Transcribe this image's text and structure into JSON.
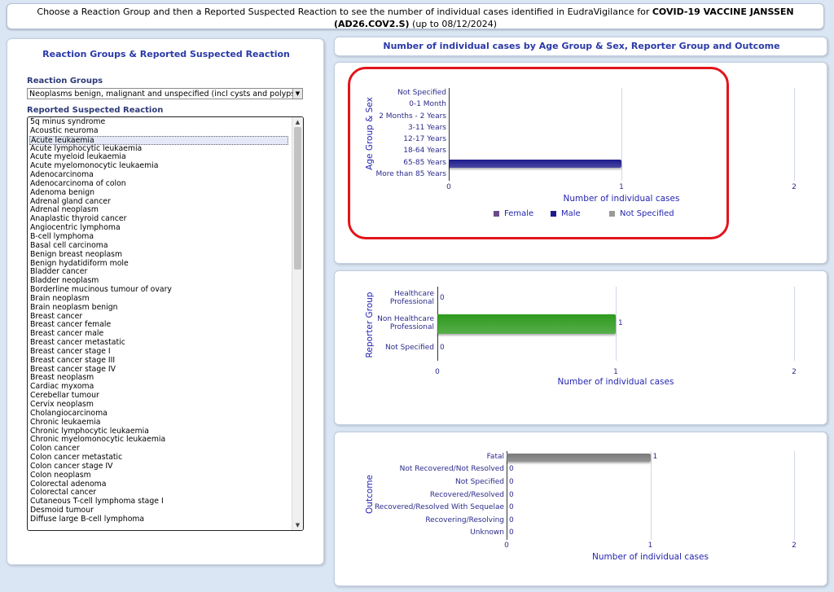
{
  "header": {
    "line1_prefix": "Choose a Reaction Group and then a Reported Suspected Reaction to see the number of individual cases identified in EudraVigilance for ",
    "vaccine": "COVID-19 VACCINE JANSSEN",
    "vaccine_code": "(AD26.COV2.S)",
    "date_note": " (up to 08/12/2024)"
  },
  "left_panel": {
    "title": "Reaction Groups & Reported Suspected Reaction",
    "reaction_groups_label": "Reaction Groups",
    "reaction_group_selected": "Neoplasms benign, malignant and unspecified (incl cysts and polyps)",
    "reported_reaction_label": "Reported Suspected Reaction",
    "reactions": [
      "5q minus syndrome",
      "Acoustic neuroma",
      "Acute leukaemia",
      "Acute lymphocytic leukaemia",
      "Acute myeloid leukaemia",
      "Acute myelomonocytic leukaemia",
      "Adenocarcinoma",
      "Adenocarcinoma of colon",
      "Adenoma benign",
      "Adrenal gland cancer",
      "Adrenal neoplasm",
      "Anaplastic thyroid cancer",
      "Angiocentric lymphoma",
      "B-cell lymphoma",
      "Basal cell carcinoma",
      "Benign breast neoplasm",
      "Benign hydatidiform mole",
      "Bladder cancer",
      "Bladder neoplasm",
      "Borderline mucinous tumour of ovary",
      "Brain neoplasm",
      "Brain neoplasm benign",
      "Breast cancer",
      "Breast cancer female",
      "Breast cancer male",
      "Breast cancer metastatic",
      "Breast cancer stage I",
      "Breast cancer stage III",
      "Breast cancer stage IV",
      "Breast neoplasm",
      "Cardiac myxoma",
      "Cerebellar tumour",
      "Cervix neoplasm",
      "Cholangiocarcinoma",
      "Chronic leukaemia",
      "Chronic lymphocytic leukaemia",
      "Chronic myelomonocytic leukaemia",
      "Colon cancer",
      "Colon cancer metastatic",
      "Colon cancer stage IV",
      "Colon neoplasm",
      "Colorectal adenoma",
      "Colorectal cancer",
      "Cutaneous T-cell lymphoma stage I",
      "Desmoid tumour",
      "Diffuse large B-cell lymphoma"
    ],
    "selected_reaction": "Acute leukaemia"
  },
  "right_header": "Number of individual cases by Age Group & Sex, Reporter Group and Outcome",
  "charts": {
    "x_axis_title": "Number of individual cases",
    "x_ticks": [
      "0",
      "1",
      "2"
    ]
  },
  "chart_data": [
    {
      "type": "bar",
      "orientation": "horizontal",
      "ylabel": "Age Group & Sex",
      "xlabel": "Number of individual cases",
      "categories": [
        "Not Specified",
        "0-1 Month",
        "2 Months - 2 Years",
        "3-11 Years",
        "12-17 Years",
        "18-64 Years",
        "65-85 Years",
        "More than 85 Years"
      ],
      "series": [
        {
          "name": "Female",
          "color": "#6a4a8a",
          "values": [
            0,
            0,
            0,
            0,
            0,
            0,
            0,
            0
          ]
        },
        {
          "name": "Male",
          "color": "#1d1a8c",
          "values": [
            0,
            0,
            0,
            0,
            0,
            0,
            1,
            0
          ]
        },
        {
          "name": "Not Specified",
          "color": "#9a9a9a",
          "values": [
            0,
            0,
            0,
            0,
            0,
            0,
            0,
            0
          ]
        }
      ],
      "xlim": [
        0,
        2
      ],
      "legend": "bottom"
    },
    {
      "type": "bar",
      "orientation": "horizontal",
      "ylabel": "Reporter Group",
      "xlabel": "Number of individual cases",
      "categories": [
        "Healthcare Professional",
        "Non Healthcare Professional",
        "Not Specified"
      ],
      "values": [
        0,
        1,
        0
      ],
      "color": "#2e9a1e",
      "xlim": [
        0,
        2
      ]
    },
    {
      "type": "bar",
      "orientation": "horizontal",
      "ylabel": "Outcome",
      "xlabel": "Number of individual cases",
      "categories": [
        "Fatal",
        "Not Recovered/Not Resolved",
        "Not Specified",
        "Recovered/Resolved",
        "Recovered/Resolved With Sequelae",
        "Recovering/Resolving",
        "Unknown"
      ],
      "values": [
        1,
        0,
        0,
        0,
        0,
        0,
        0
      ],
      "color": "#7a7a7a",
      "xlim": [
        0,
        2
      ]
    }
  ]
}
